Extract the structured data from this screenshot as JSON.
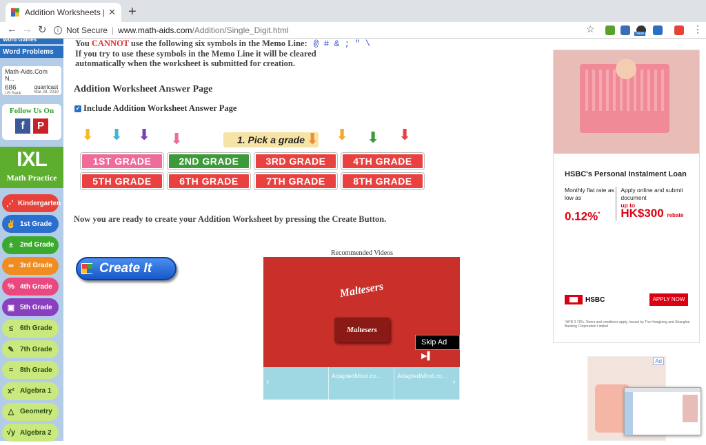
{
  "browser": {
    "tab_title": "Addition Worksheets | Single D",
    "tab_close": "✕",
    "new_tab": "+",
    "security_label": "Not Secure",
    "url_domain": "www.math-aids.com",
    "url_path": "/Addition/Single_Digit.html",
    "ext_new_badge": "New"
  },
  "sidebar": {
    "top_link": "Word Games",
    "word_problems": "Word Problems",
    "rank": {
      "title": "Math-Aids.Com N...",
      "number": "686",
      "number_label": "US Rank",
      "source": "quantcast",
      "date": "Mar 28, 2019"
    },
    "follow_title": "Follow Us On",
    "facebook": "f",
    "pinterest": "P",
    "ixl_logo": "IXL",
    "ixl_sub": "Math Practice",
    "grades": [
      {
        "label": "Kindergarten",
        "icon": "⋰",
        "color": "#e8413a"
      },
      {
        "label": "1st Grade",
        "icon": "✌",
        "color": "#2b6fce"
      },
      {
        "label": "2nd Grade",
        "icon": "±",
        "color": "#3aa92d"
      },
      {
        "label": "3rd Grade",
        "icon": "∞",
        "color": "#ef8c22"
      },
      {
        "label": "4th Grade",
        "icon": "%",
        "color": "#e9497f"
      },
      {
        "label": "5th Grade",
        "icon": "▣",
        "color": "#8a3fbf"
      },
      {
        "label": "6th Grade",
        "icon": "≤",
        "color": "#c9e87e"
      },
      {
        "label": "7th Grade",
        "icon": "✎",
        "color": "#c9e87e"
      },
      {
        "label": "8th Grade",
        "icon": "≈",
        "color": "#c9e87e"
      },
      {
        "label": "Algebra 1",
        "icon": "x²",
        "color": "#c9e87e"
      },
      {
        "label": "Geometry",
        "icon": "△",
        "color": "#c9e87e"
      },
      {
        "label": "Algebra 2",
        "icon": "√y",
        "color": "#c9e87e"
      }
    ]
  },
  "main": {
    "memo_prefix": "You",
    "memo_cannot": "CANNOT",
    "memo_line1_rest": "use the following six symbols in the Memo Line:",
    "memo_symbols": "@ # & ; \" \\",
    "memo_line2": "If you try to use these symbols in the Memo Line it will be cleared",
    "memo_line3": "automatically when the worksheet is submitted for creation.",
    "answer_heading": "Addition Worksheet Answer Page",
    "answer_checkbox_label": "Include Addition Worksheet Answer Page",
    "answer_checked": true,
    "pick_grade": "1. Pick a grade",
    "grade_buttons": [
      {
        "label": "1ST GRADE",
        "color": "#ef6b9a"
      },
      {
        "label": "2ND GRADE",
        "color": "#3d9a3a"
      },
      {
        "label": "3RD GRADE",
        "color": "#e9413f"
      },
      {
        "label": "4TH GRADE",
        "color": "#e9413f"
      },
      {
        "label": "5TH GRADE",
        "color": "#e9413f"
      },
      {
        "label": "6TH GRADE",
        "color": "#e9413f"
      },
      {
        "label": "7TH GRADE",
        "color": "#e9413f"
      },
      {
        "label": "8TH GRADE",
        "color": "#e9413f"
      }
    ],
    "ready_text": "Now you are ready to create your Addition Worksheet by pressing the Create Button.",
    "create_button": "Create It",
    "recommended_label": "Recommended Videos",
    "video_brand": "Maltesers",
    "skip_ad": "Skip Ad ▶▌",
    "thumbs": [
      "AdaptedMind.co...",
      "AdaptedMind.co...",
      "AdaptedMind.co..."
    ]
  },
  "ad": {
    "title": "HSBC's Personal Instalment Loan",
    "col1_text": "Monthly flat rate as low as",
    "col1_value": "0.12%",
    "col1_note": "*",
    "col2_text": "Apply online and submit document",
    "col2_upto": "up to",
    "col2_value": "HK$300",
    "col2_suffix": "rebate",
    "brand": "HSBC",
    "apply_button": "APPLY NOW",
    "fine_print": "*APR 2.76%. Terms and conditions apply. Issued by The Hongkong and Shanghai Banking Corporation Limited",
    "ad_badge": "Ad"
  },
  "colors": {
    "accent_blue": "#2a6fc0",
    "sidebar_bg": "#b3cde8",
    "hsbc_red": "#db0011"
  }
}
